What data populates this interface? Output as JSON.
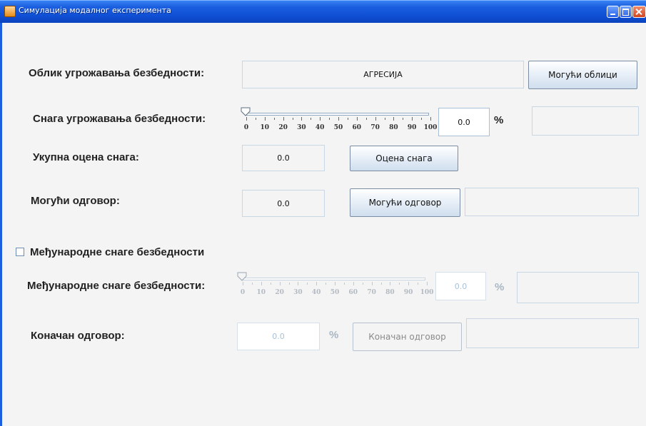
{
  "window": {
    "title": "Симулација модалног експеримента"
  },
  "form": {
    "threat_form": {
      "label": "Облик угрожавања безбедности:",
      "value": "АГРЕСИЈА",
      "button": "Могући облици"
    },
    "threat_strength": {
      "label": "Снага угрожавања безбедности:",
      "slider_value": 0,
      "slider_ticks": [
        "0",
        "10",
        "20",
        "30",
        "40",
        "50",
        "60",
        "70",
        "80",
        "90",
        "100"
      ],
      "value": "0.0",
      "unit": "%",
      "extra": ""
    },
    "total_assessment": {
      "label": "Укупна оцена снага:",
      "value": "0.0",
      "button": "Оцена снага"
    },
    "possible_response": {
      "label": "Могући одговор:",
      "value": "0.0",
      "button": "Могући одговор",
      "extra": ""
    },
    "international_checkbox": {
      "label": "Међународне снаге безбедности",
      "checked": false
    },
    "international_strength": {
      "label": "Међународне снаге безбедности:",
      "slider_value": 0,
      "slider_ticks": [
        "0",
        "10",
        "20",
        "30",
        "40",
        "50",
        "60",
        "70",
        "80",
        "90",
        "100"
      ],
      "value": "0.0",
      "unit": "%",
      "extra": ""
    },
    "final_response": {
      "label": "Коначан одговор:",
      "value": "0.0",
      "unit": "%",
      "button": "Коначан одговор",
      "extra": ""
    }
  },
  "colors": {
    "title_bar": "#0f4fd4",
    "background": "#f4f4f4",
    "field_border": "#c9d6e4",
    "disabled_text": "#a9c0d8"
  }
}
